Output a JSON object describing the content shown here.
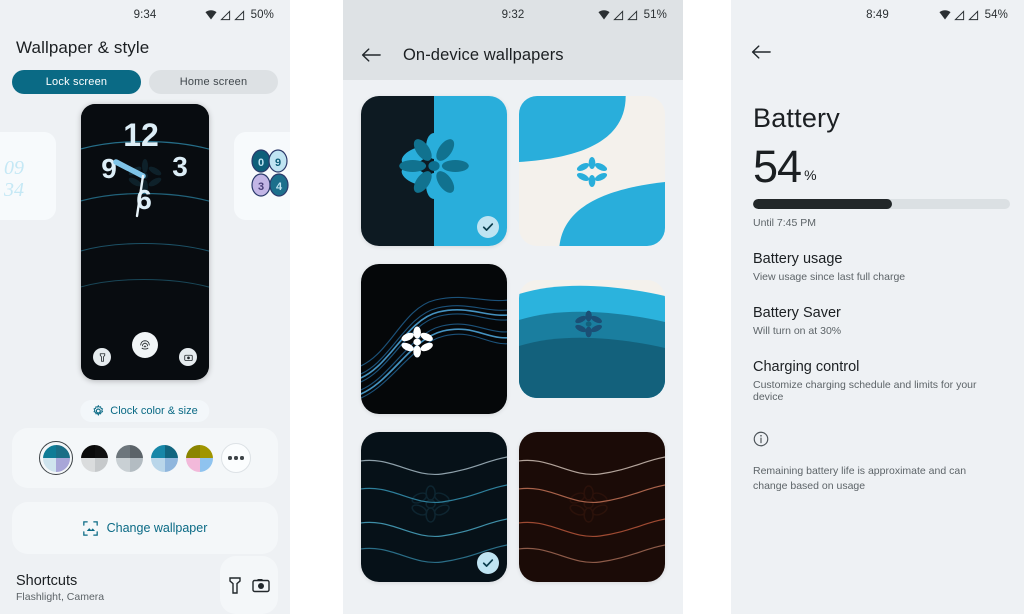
{
  "panel_wallpaper": {
    "status_bar": {
      "time": "9:34",
      "battery": "50%",
      "wifi_icon": "wifi-icon",
      "signal_icon": "signal-icon"
    },
    "page_title": "Wallpaper & style",
    "tabs": [
      {
        "label": "Lock screen",
        "selected": true
      },
      {
        "label": "Home screen",
        "selected": false
      }
    ],
    "preview": {
      "left_clock_text": "09 34",
      "right_clock_text": "09 34",
      "clock_hour": "12",
      "clock_numbers": [
        "12",
        "3",
        "6",
        "9"
      ],
      "left_shortcut_icon": "flashlight-icon",
      "center_icon": "fingerprint-icon",
      "right_shortcut_icon": "camera-icon"
    },
    "clock_chip": {
      "label": "Clock color & size",
      "icon": "gear-icon"
    },
    "color_swatches": [
      {
        "name": "swatch-teal",
        "selected": true,
        "quadrants": [
          "#0f7c96",
          "#1b6e86",
          "#cfe4ee",
          "#a8a6d8"
        ]
      },
      {
        "name": "swatch-black",
        "selected": false,
        "quadrants": [
          "#0a0a0a",
          "#101010",
          "#dadcdd",
          "#c6c9cb"
        ]
      },
      {
        "name": "swatch-grey",
        "selected": false,
        "quadrants": [
          "#6d767c",
          "#5b6369",
          "#c9d0d4",
          "#b3bcc2"
        ]
      },
      {
        "name": "swatch-blue",
        "selected": false,
        "quadrants": [
          "#1787a8",
          "#11657f",
          "#b9d6ea",
          "#8fb6dd"
        ]
      },
      {
        "name": "swatch-olive",
        "selected": false,
        "quadrants": [
          "#8a8400",
          "#a09500",
          "#f2b9da",
          "#8fc3ef"
        ]
      }
    ],
    "more_colors_label": "more-colors",
    "change_wallpaper": {
      "label": "Change wallpaper",
      "icon": "wallpaper-icon"
    },
    "shortcuts": {
      "title": "Shortcuts",
      "subtitle": "Flashlight, Camera",
      "icons": [
        "flashlight-icon",
        "camera-icon"
      ]
    }
  },
  "panel_onDevice": {
    "status_bar": {
      "time": "9:32",
      "battery": "51%",
      "wifi_icon": "wifi-icon",
      "signal_icon": "signal-icon"
    },
    "back_icon": "back-arrow-icon",
    "title": "On-device wallpapers",
    "wallpapers": [
      {
        "name": "wallpaper-split-dark-teal",
        "selected": true,
        "style": "split"
      },
      {
        "name": "wallpaper-cream-teal-curves",
        "selected": false,
        "style": "curves"
      },
      {
        "name": "wallpaper-dark-blue-waves",
        "selected": false,
        "style": "waves-dark"
      },
      {
        "name": "wallpaper-teal-layers",
        "selected": false,
        "style": "layers"
      },
      {
        "name": "wallpaper-dark-lines-blue",
        "selected": true,
        "style": "lines-blue"
      },
      {
        "name": "wallpaper-dark-lines-red",
        "selected": false,
        "style": "lines-red"
      }
    ],
    "check_icon": "check-icon"
  },
  "panel_battery": {
    "status_bar": {
      "time": "8:49",
      "battery": "54%",
      "wifi_icon": "wifi-icon",
      "signal_icon": "signal-icon"
    },
    "back_icon": "back-arrow-icon",
    "title": "Battery",
    "percent_value": "54",
    "percent_symbol": "%",
    "level": 54,
    "until_text": "Until 7:45 PM",
    "items": [
      {
        "title": "Battery usage",
        "subtitle": "View usage since last full charge"
      },
      {
        "title": "Battery Saver",
        "subtitle": "Will turn on at 30%"
      },
      {
        "title": "Charging control",
        "subtitle": "Customize charging schedule and limits for your device"
      }
    ],
    "info_icon": "info-icon",
    "note": "Remaining battery life is approximate and can change based on usage"
  },
  "theme": {
    "accent": "#0a6a85",
    "panel_bg": "#eef1f4",
    "card_bg": "#f4f7f9",
    "header_bg": "#dee2e5",
    "text_primary": "#1b1f22",
    "text_secondary": "#5d6468"
  }
}
